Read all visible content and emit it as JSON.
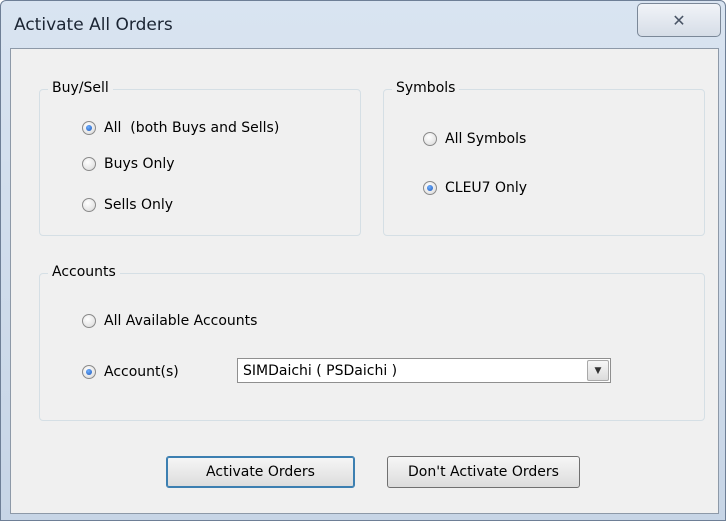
{
  "window": {
    "title": "Activate All Orders",
    "close_icon": "close-icon",
    "close_glyph": "✕"
  },
  "buy_sell": {
    "label": "Buy/Sell",
    "options": [
      {
        "label": "All  (both Buys and Sells)",
        "checked": true
      },
      {
        "label": "Buys Only",
        "checked": false
      },
      {
        "label": "Sells Only",
        "checked": false
      }
    ]
  },
  "symbols": {
    "label": "Symbols",
    "options": [
      {
        "label": "All Symbols",
        "checked": false
      },
      {
        "label": "CLEU7 Only",
        "checked": true
      }
    ]
  },
  "accounts": {
    "label": "Accounts",
    "options": [
      {
        "label": "All Available Accounts",
        "checked": false
      },
      {
        "label": "Account(s)",
        "checked": true
      }
    ],
    "dropdown": {
      "selected": "SIMDaichi ( PSDaichi )",
      "arrow_icon": "chevron-down-icon",
      "arrow_glyph": "▼"
    }
  },
  "buttons": {
    "activate": "Activate Orders",
    "dont_activate": "Don't Activate Orders"
  },
  "colors": {
    "title_bar": "#c7d5e6",
    "dialog_bg": "#f0f0f0",
    "radio_selected": "#1d56b8"
  }
}
